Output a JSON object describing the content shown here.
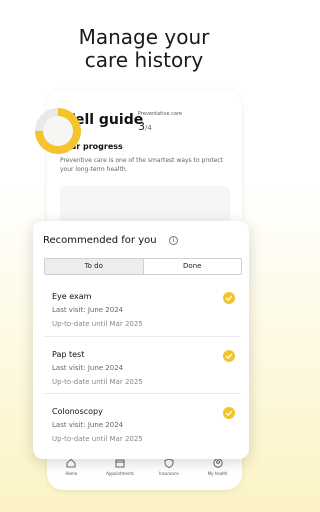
{
  "headline": {
    "line1": "Manage your",
    "line2": "care history"
  },
  "well_guide": {
    "title": "Well guide",
    "progress_title": "Your progress",
    "progress_desc": "Preventive care is one of the smartest ways to protect your long-term health.",
    "preventive_label": "Preventative care",
    "score_done": "3",
    "score_total": "/4",
    "progress_fraction": 0.75
  },
  "recommended": {
    "title": "Recommended for you",
    "tabs": {
      "todo": "To do",
      "done": "Done"
    },
    "items": [
      {
        "name": "Eye exam",
        "last_visit": "Last visit: June 2024",
        "up_to_date": "Up-to-date until Mar 2025"
      },
      {
        "name": "Pap test",
        "last_visit": "Last visit: June 2024",
        "up_to_date": "Up-to-date until Mar 2025"
      },
      {
        "name": "Colonoscopy",
        "last_visit": "Last visit: June 2024",
        "up_to_date": "Up-to-date until Mar 2025"
      }
    ]
  },
  "nav": {
    "home": "Home",
    "appointments": "Appointments",
    "insurance": "Insurance",
    "my_health": "My health"
  },
  "colors": {
    "accent": "#f5c42c",
    "background_bottom": "#fbf3c4"
  }
}
